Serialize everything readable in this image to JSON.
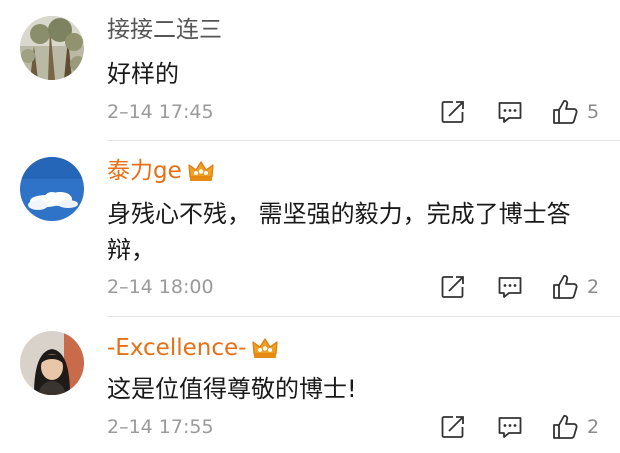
{
  "comments": [
    {
      "username": "接接二连三",
      "vip": false,
      "avatar": "tree-photo-avatar",
      "text": "好样的",
      "time": "2–14 17:45",
      "likes": "5",
      "icons": {
        "forward": "share-icon",
        "comment": "comment-icon",
        "like": "thumbs-up-icon"
      }
    },
    {
      "username": "泰力ge",
      "vip": true,
      "avatar": "sky-cloud-avatar",
      "text": "身残心不残， 需坚强的毅力，完成了博士答辩，",
      "time": "2–14 18:00",
      "likes": "2",
      "icons": {
        "forward": "share-icon",
        "comment": "comment-icon",
        "like": "thumbs-up-icon"
      }
    },
    {
      "username": "-Excellence-",
      "vip": true,
      "avatar": "portrait-photo-avatar",
      "text": "这是位值得尊敬的博士!",
      "time": "2–14 17:55",
      "likes": "2",
      "icons": {
        "forward": "share-icon",
        "comment": "comment-icon",
        "like": "thumbs-up-icon"
      }
    }
  ],
  "colors": {
    "vip_name": "#e86f15",
    "plain_name": "#555555",
    "text": "#1a1a1a",
    "meta": "#9a9a9a",
    "crown": "#f0a020"
  },
  "vip_badge_icon": "crown-badge-icon"
}
